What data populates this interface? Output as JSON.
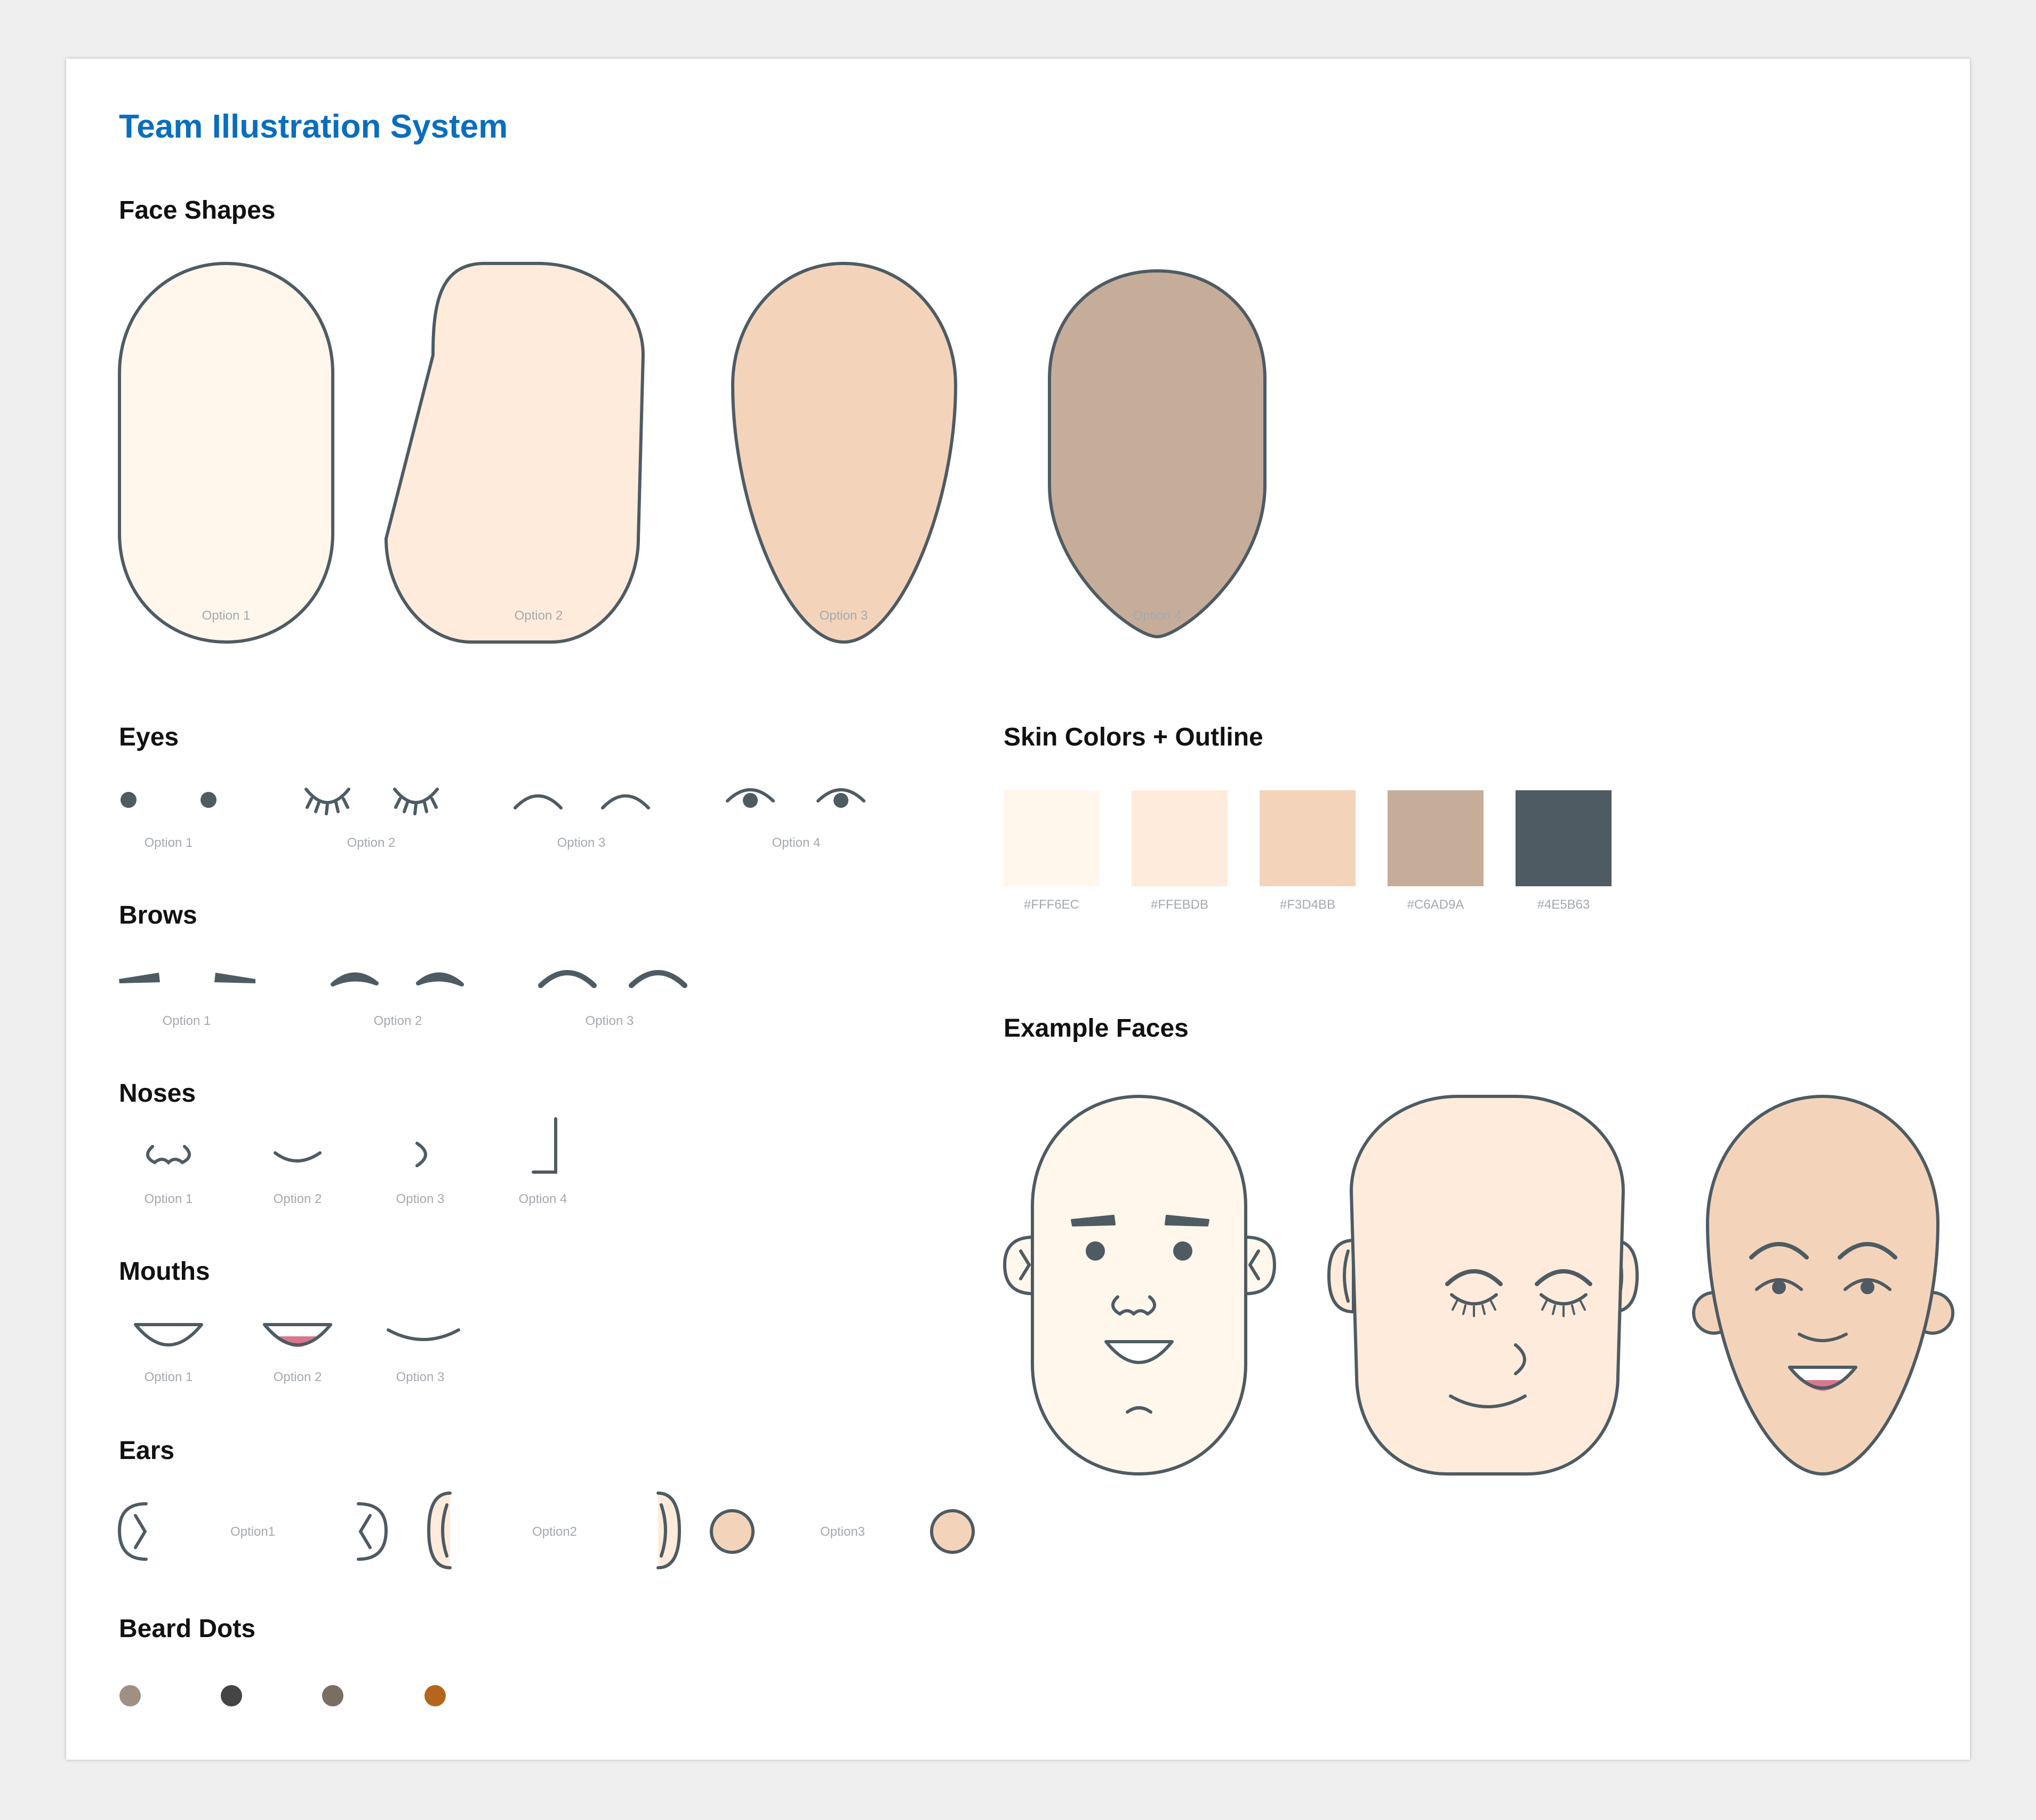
{
  "title": "Team Illustration System",
  "colors": {
    "title": "#0A6EBD",
    "outline": "#4E5B63",
    "mouth_pink": "#D9788A",
    "skin": [
      "#FFF6EC",
      "#FFEBDB",
      "#F3D4BB",
      "#C6AD9A",
      "#4E5B63"
    ]
  },
  "sections": {
    "face_shapes": {
      "heading": "Face Shapes",
      "options": [
        "Option 1",
        "Option 2",
        "Option 3",
        "Option 4"
      ]
    },
    "eyes": {
      "heading": "Eyes",
      "options": [
        "Option 1",
        "Option 2",
        "Option 3",
        "Option 4"
      ]
    },
    "brows": {
      "heading": "Brows",
      "options": [
        "Option 1",
        "Option 2",
        "Option 3"
      ]
    },
    "noses": {
      "heading": "Noses",
      "options": [
        "Option 1",
        "Option 2",
        "Option 3",
        "Option 4"
      ]
    },
    "mouths": {
      "heading": "Mouths",
      "options": [
        "Option 1",
        "Option 2",
        "Option 3"
      ]
    },
    "ears": {
      "heading": "Ears",
      "options": [
        "Option1",
        "Option2",
        "Option3"
      ]
    },
    "beard_dots": {
      "heading": "Beard Dots",
      "colors": [
        "#A09084",
        "#444444",
        "#7A6E63",
        "#B5651D"
      ]
    },
    "skin_colors": {
      "heading": "Skin Colors + Outline",
      "swatches": [
        "#FFF6EC",
        "#FFEBDB",
        "#F3D4BB",
        "#C6AD9A",
        "#4E5B63"
      ]
    },
    "example_faces": {
      "heading": "Example Faces"
    }
  }
}
